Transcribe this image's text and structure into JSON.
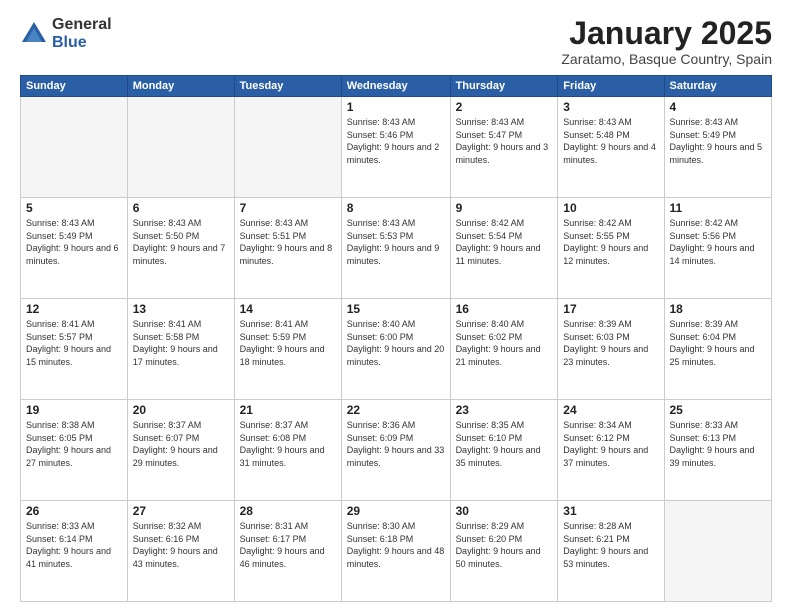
{
  "logo": {
    "general": "General",
    "blue": "Blue"
  },
  "title": "January 2025",
  "subtitle": "Zaratamo, Basque Country, Spain",
  "days_header": [
    "Sunday",
    "Monday",
    "Tuesday",
    "Wednesday",
    "Thursday",
    "Friday",
    "Saturday"
  ],
  "weeks": [
    [
      {
        "day": "",
        "empty": true
      },
      {
        "day": "",
        "empty": true
      },
      {
        "day": "",
        "empty": true
      },
      {
        "day": "1",
        "sunrise": "8:43 AM",
        "sunset": "5:46 PM",
        "daylight": "9 hours and 2 minutes."
      },
      {
        "day": "2",
        "sunrise": "8:43 AM",
        "sunset": "5:47 PM",
        "daylight": "9 hours and 3 minutes."
      },
      {
        "day": "3",
        "sunrise": "8:43 AM",
        "sunset": "5:48 PM",
        "daylight": "9 hours and 4 minutes."
      },
      {
        "day": "4",
        "sunrise": "8:43 AM",
        "sunset": "5:49 PM",
        "daylight": "9 hours and 5 minutes."
      }
    ],
    [
      {
        "day": "5",
        "sunrise": "8:43 AM",
        "sunset": "5:49 PM",
        "daylight": "9 hours and 6 minutes."
      },
      {
        "day": "6",
        "sunrise": "8:43 AM",
        "sunset": "5:50 PM",
        "daylight": "9 hours and 7 minutes."
      },
      {
        "day": "7",
        "sunrise": "8:43 AM",
        "sunset": "5:51 PM",
        "daylight": "9 hours and 8 minutes."
      },
      {
        "day": "8",
        "sunrise": "8:43 AM",
        "sunset": "5:53 PM",
        "daylight": "9 hours and 9 minutes."
      },
      {
        "day": "9",
        "sunrise": "8:42 AM",
        "sunset": "5:54 PM",
        "daylight": "9 hours and 11 minutes."
      },
      {
        "day": "10",
        "sunrise": "8:42 AM",
        "sunset": "5:55 PM",
        "daylight": "9 hours and 12 minutes."
      },
      {
        "day": "11",
        "sunrise": "8:42 AM",
        "sunset": "5:56 PM",
        "daylight": "9 hours and 14 minutes."
      }
    ],
    [
      {
        "day": "12",
        "sunrise": "8:41 AM",
        "sunset": "5:57 PM",
        "daylight": "9 hours and 15 minutes."
      },
      {
        "day": "13",
        "sunrise": "8:41 AM",
        "sunset": "5:58 PM",
        "daylight": "9 hours and 17 minutes."
      },
      {
        "day": "14",
        "sunrise": "8:41 AM",
        "sunset": "5:59 PM",
        "daylight": "9 hours and 18 minutes."
      },
      {
        "day": "15",
        "sunrise": "8:40 AM",
        "sunset": "6:00 PM",
        "daylight": "9 hours and 20 minutes."
      },
      {
        "day": "16",
        "sunrise": "8:40 AM",
        "sunset": "6:02 PM",
        "daylight": "9 hours and 21 minutes."
      },
      {
        "day": "17",
        "sunrise": "8:39 AM",
        "sunset": "6:03 PM",
        "daylight": "9 hours and 23 minutes."
      },
      {
        "day": "18",
        "sunrise": "8:39 AM",
        "sunset": "6:04 PM",
        "daylight": "9 hours and 25 minutes."
      }
    ],
    [
      {
        "day": "19",
        "sunrise": "8:38 AM",
        "sunset": "6:05 PM",
        "daylight": "9 hours and 27 minutes."
      },
      {
        "day": "20",
        "sunrise": "8:37 AM",
        "sunset": "6:07 PM",
        "daylight": "9 hours and 29 minutes."
      },
      {
        "day": "21",
        "sunrise": "8:37 AM",
        "sunset": "6:08 PM",
        "daylight": "9 hours and 31 minutes."
      },
      {
        "day": "22",
        "sunrise": "8:36 AM",
        "sunset": "6:09 PM",
        "daylight": "9 hours and 33 minutes."
      },
      {
        "day": "23",
        "sunrise": "8:35 AM",
        "sunset": "6:10 PM",
        "daylight": "9 hours and 35 minutes."
      },
      {
        "day": "24",
        "sunrise": "8:34 AM",
        "sunset": "6:12 PM",
        "daylight": "9 hours and 37 minutes."
      },
      {
        "day": "25",
        "sunrise": "8:33 AM",
        "sunset": "6:13 PM",
        "daylight": "9 hours and 39 minutes."
      }
    ],
    [
      {
        "day": "26",
        "sunrise": "8:33 AM",
        "sunset": "6:14 PM",
        "daylight": "9 hours and 41 minutes."
      },
      {
        "day": "27",
        "sunrise": "8:32 AM",
        "sunset": "6:16 PM",
        "daylight": "9 hours and 43 minutes."
      },
      {
        "day": "28",
        "sunrise": "8:31 AM",
        "sunset": "6:17 PM",
        "daylight": "9 hours and 46 minutes."
      },
      {
        "day": "29",
        "sunrise": "8:30 AM",
        "sunset": "6:18 PM",
        "daylight": "9 hours and 48 minutes."
      },
      {
        "day": "30",
        "sunrise": "8:29 AM",
        "sunset": "6:20 PM",
        "daylight": "9 hours and 50 minutes."
      },
      {
        "day": "31",
        "sunrise": "8:28 AM",
        "sunset": "6:21 PM",
        "daylight": "9 hours and 53 minutes."
      },
      {
        "day": "",
        "empty": true
      }
    ]
  ]
}
